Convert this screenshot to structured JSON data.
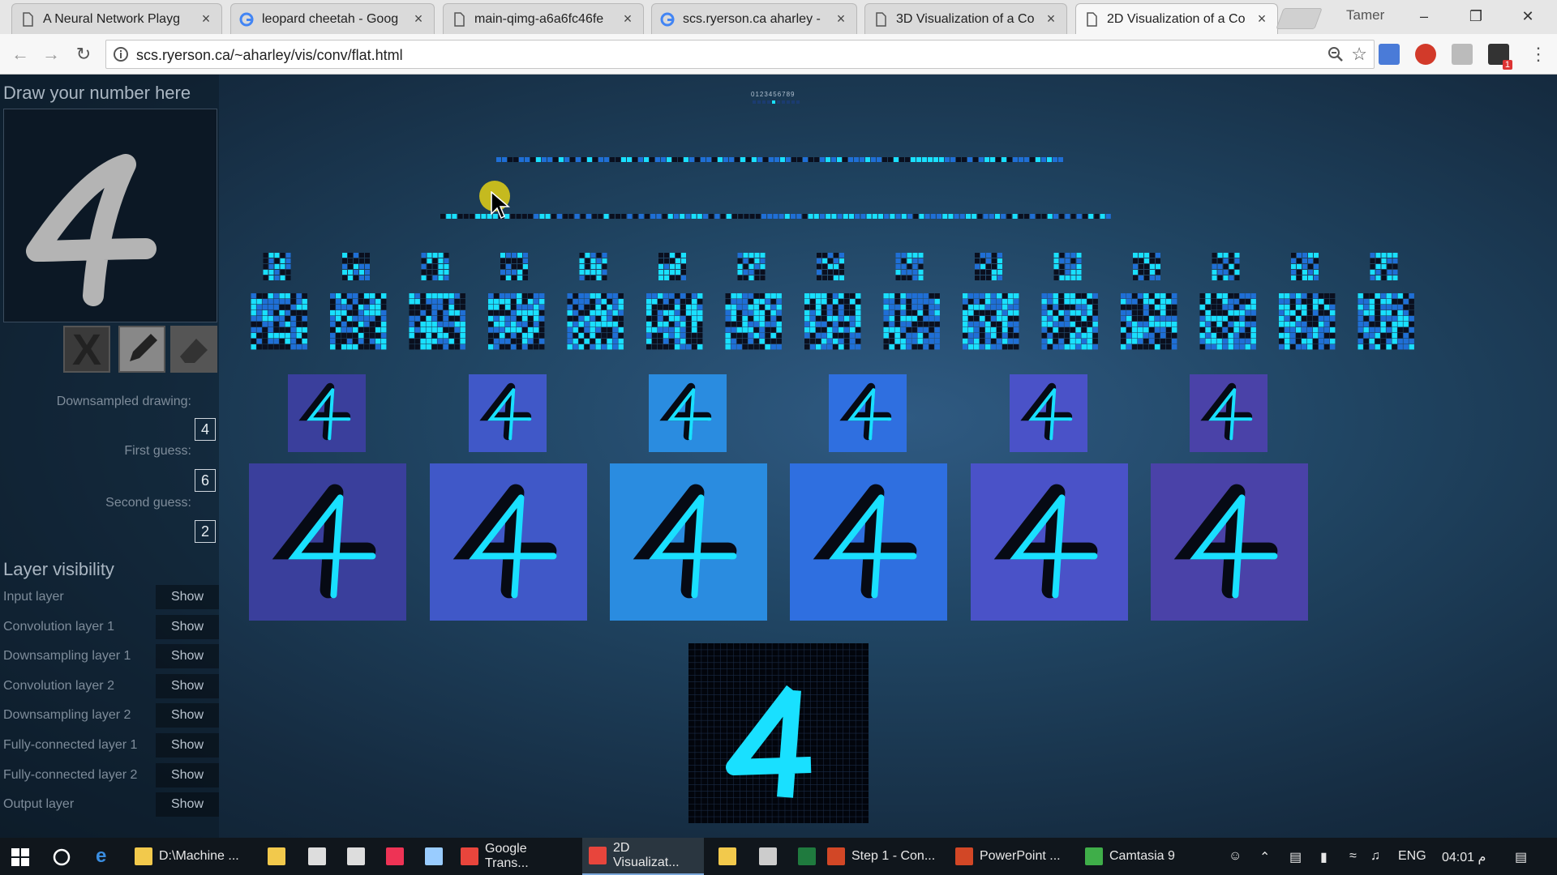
{
  "browser": {
    "tabs": [
      {
        "title": "A Neural Network Playg",
        "favicon": "page-icon",
        "active": false
      },
      {
        "title": "leopard cheetah - Goog",
        "favicon": "google-icon",
        "active": false
      },
      {
        "title": "main-qimg-a6a6fc46fe",
        "favicon": "page-icon",
        "active": false
      },
      {
        "title": "scs.ryerson.ca aharley -",
        "favicon": "google-icon",
        "active": false
      },
      {
        "title": "3D Visualization of a Co",
        "favicon": "page-icon",
        "active": false
      },
      {
        "title": "2D Visualization of a Co",
        "favicon": "page-icon",
        "active": true
      }
    ],
    "profile_name": "Tamer",
    "url": "scs.ryerson.ca/~aharley/vis/conv/flat.html",
    "extension_badge": "1"
  },
  "page": {
    "draw_title": "Draw your number here",
    "drawn_digit": "4",
    "tools": {
      "clear": "X",
      "pencil": "pencil-icon",
      "eraser": "eraser-icon"
    },
    "downsampled_label": "Downsampled drawing:",
    "downsampled_value": "4",
    "first_guess_label": "First guess:",
    "first_guess_value": "6",
    "second_guess_label": "Second guess:",
    "second_guess_value": "2",
    "layer_visibility_title": "Layer visibility",
    "layers": [
      {
        "name": "Input layer",
        "button": "Show"
      },
      {
        "name": "Convolution layer 1",
        "button": "Show"
      },
      {
        "name": "Downsampling layer 1",
        "button": "Show"
      },
      {
        "name": "Convolution layer 2",
        "button": "Show"
      },
      {
        "name": "Downsampling layer 2",
        "button": "Show"
      },
      {
        "name": "Fully-connected layer 1",
        "button": "Show"
      },
      {
        "name": "Fully-connected layer 2",
        "button": "Show"
      },
      {
        "name": "Output layer",
        "button": "Show"
      }
    ],
    "output_digits": "0123456789",
    "accent_color": "#19e0ff"
  },
  "taskbar": {
    "items": [
      {
        "label": "D:\\Machine ...",
        "icon": "folder-icon",
        "color": "#f2c94c",
        "active": false
      },
      {
        "label": "Google Trans...",
        "icon": "chrome-icon",
        "color": "#e8453c",
        "active": false
      },
      {
        "label": "2D Visualizat...",
        "icon": "chrome-icon",
        "color": "#e8453c",
        "active": true
      },
      {
        "label": "Step 1 - Con...",
        "icon": "powerpoint-icon",
        "color": "#d24726",
        "active": false
      },
      {
        "label": "PowerPoint ...",
        "icon": "powerpoint-icon",
        "color": "#d24726",
        "active": false
      },
      {
        "label": "Camtasia 9",
        "icon": "camtasia-icon",
        "color": "#3fae49",
        "active": false
      }
    ],
    "language": "ENG",
    "time": "04:01 م"
  }
}
